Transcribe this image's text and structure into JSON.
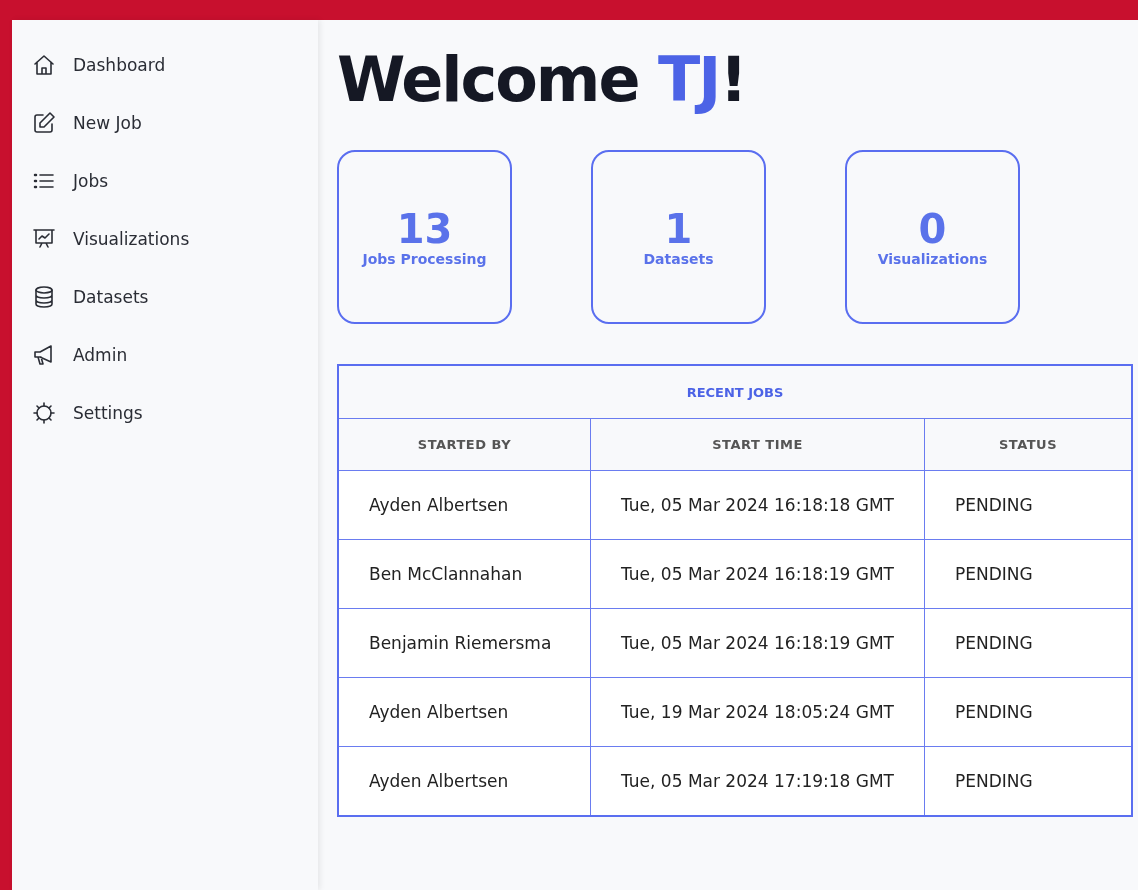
{
  "sidebar": {
    "items": [
      {
        "label": "Dashboard"
      },
      {
        "label": "New Job"
      },
      {
        "label": "Jobs"
      },
      {
        "label": "Visualizations"
      },
      {
        "label": "Datasets"
      },
      {
        "label": "Admin"
      },
      {
        "label": "Settings"
      }
    ]
  },
  "heading": {
    "greeting": "Welcome",
    "name": "TJ",
    "punctuation": "!"
  },
  "stats": [
    {
      "value": "13",
      "label": "Jobs Processing"
    },
    {
      "value": "1",
      "label": "Datasets"
    },
    {
      "value": "0",
      "label": "Visualizations"
    }
  ],
  "table": {
    "title": "RECENT JOBS",
    "columns": [
      "STARTED BY",
      "START TIME",
      "STATUS"
    ],
    "rows": [
      [
        "Ayden Albertsen",
        "Tue, 05 Mar 2024 16:18:18 GMT",
        "PENDING"
      ],
      [
        "Ben McClannahan",
        "Tue, 05 Mar 2024 16:18:19 GMT",
        "PENDING"
      ],
      [
        "Benjamin Riemersma",
        "Tue, 05 Mar 2024 16:18:19 GMT",
        "PENDING"
      ],
      [
        "Ayden Albertsen",
        "Tue, 19 Mar 2024 18:05:24 GMT",
        "PENDING"
      ],
      [
        "Ayden Albertsen",
        "Tue, 05 Mar 2024 17:19:18 GMT",
        "PENDING"
      ]
    ]
  }
}
